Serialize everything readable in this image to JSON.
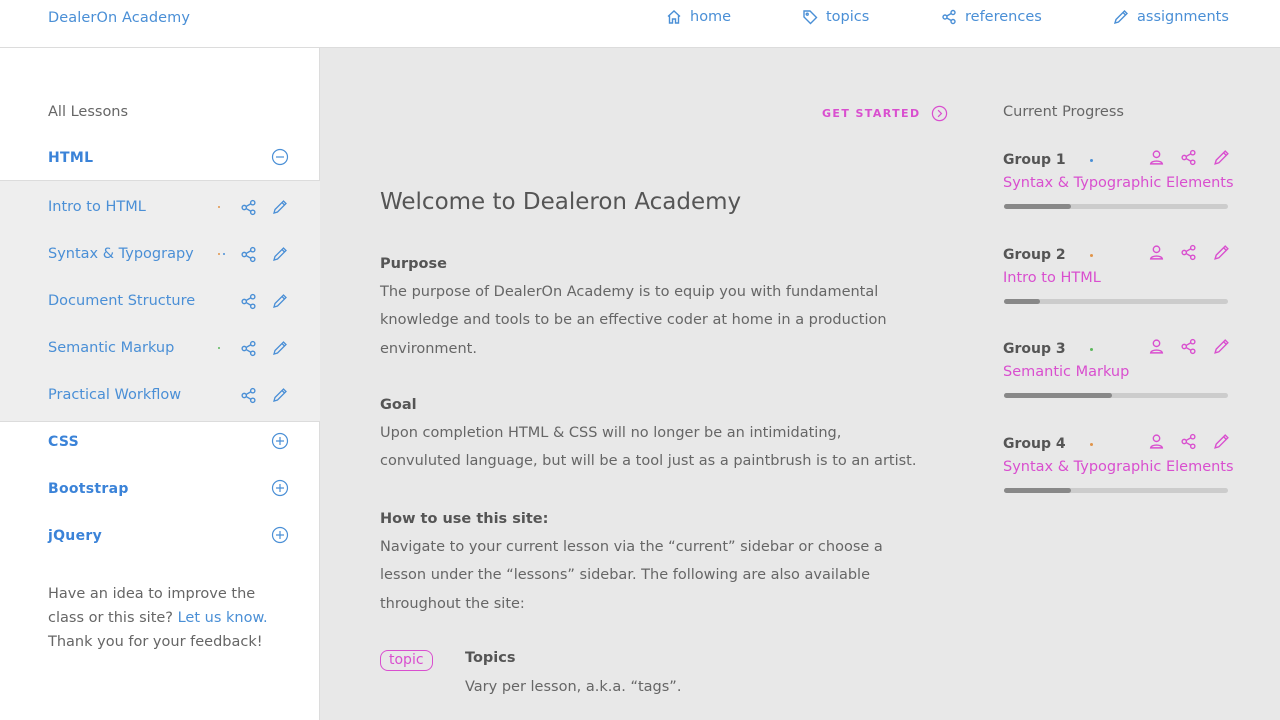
{
  "header": {
    "brand": "DealerOn Academy",
    "nav": [
      {
        "label": "home",
        "icon": "home-icon"
      },
      {
        "label": "topics",
        "icon": "tag-icon"
      },
      {
        "label": "references",
        "icon": "share-icon"
      },
      {
        "label": "assignments",
        "icon": "pencil-icon"
      }
    ]
  },
  "sidebar": {
    "title": "All Lessons",
    "sections": [
      {
        "label": "HTML",
        "expanded": true,
        "toggle_icon": "minus-circle-icon"
      },
      {
        "label": "CSS",
        "expanded": false,
        "toggle_icon": "plus-circle-icon"
      },
      {
        "label": "Bootstrap",
        "expanded": false,
        "toggle_icon": "plus-circle-icon"
      },
      {
        "label": "jQuery",
        "expanded": false,
        "toggle_icon": "plus-circle-icon"
      }
    ],
    "lessons": [
      {
        "label": "Intro to HTML",
        "dots": [
          "#e0944a"
        ]
      },
      {
        "label": "Syntax & Typograpy",
        "dots": [
          "#e0944a",
          "#4a8fd6"
        ]
      },
      {
        "label": "Document Structure",
        "dots": []
      },
      {
        "label": "Semantic Markup",
        "dots": [
          "#5cb85c"
        ]
      },
      {
        "label": "Practical Workflow",
        "dots": []
      }
    ],
    "feedback": {
      "text1": "Have an idea to improve the class or this site?",
      "link": "Let us know.",
      "text2": "Thank you for your feedback!"
    }
  },
  "main": {
    "get_started": "GET STARTED",
    "title": "Welcome to Dealeron Academy",
    "purpose_heading": "Purpose",
    "purpose_text": "The purpose of DealerOn Academy is to equip you with fundamental knowledge and tools to be an effective coder at home in a production environment.",
    "goal_heading": "Goal",
    "goal_text": "Upon completion HTML & CSS will no longer be an intimidating, convuluted language, but will be a tool just as a paintbrush is to an artist.",
    "howto_heading": "How to use this site:",
    "howto_text": "Navigate to your current lesson via the “current” sidebar or choose a lesson under the “lessons” sidebar. The following are also available throughout the site:",
    "topic_tag": "topic",
    "topics_heading": "Topics",
    "topics_text": "Vary per lesson, a.k.a. “tags”."
  },
  "progress": {
    "title": "Current Progress",
    "groups": [
      {
        "name": "Group 1",
        "lesson": "Syntax & Typographic Elements",
        "progress": 0.3,
        "dot_color": "#4a8fd6"
      },
      {
        "name": "Group 2",
        "lesson": "Intro to HTML",
        "progress": 0.16,
        "dot_color": "#e0944a"
      },
      {
        "name": "Group 3",
        "lesson": "Semantic Markup",
        "progress": 0.48,
        "dot_color": "#5cb85c"
      },
      {
        "name": "Group 4",
        "lesson": "Syntax & Typographic Elements",
        "progress": 0.3,
        "dot_color": "#e0944a"
      }
    ]
  },
  "colors": {
    "accent_blue": "#4a8fd6",
    "accent_magenta": "#d94fcf"
  }
}
